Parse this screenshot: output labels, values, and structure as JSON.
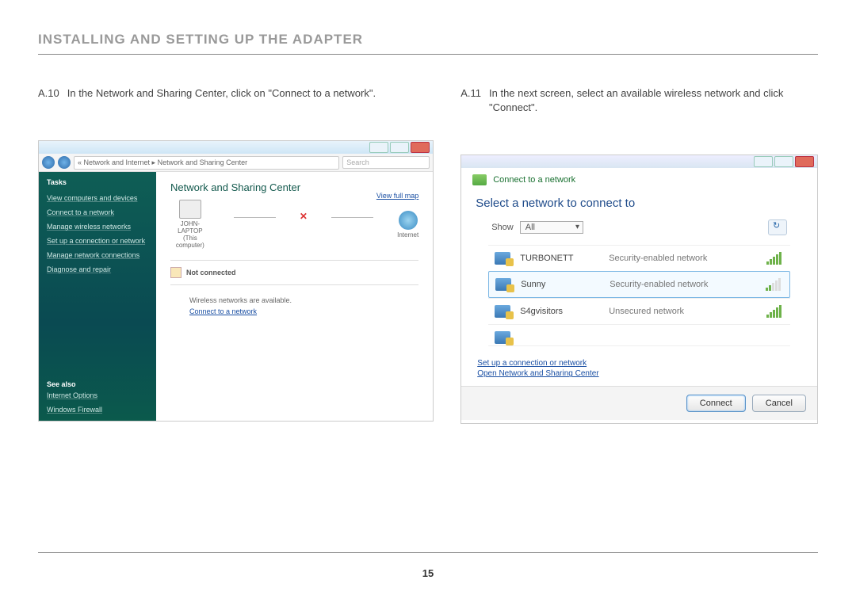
{
  "header": "INSTALLING AND SETTING UP THE ADAPTER",
  "pageNumber": "15",
  "left": {
    "stepNum": "A.10",
    "stepText": "In the Network and Sharing Center, click on \"Connect to a network\".",
    "breadcrumb": "« Network and Internet  ▸  Network and Sharing Center",
    "searchPlaceholder": "Search",
    "sidebar": {
      "heading": "Tasks",
      "items": [
        "View computers and devices",
        "Connect to a network",
        "Manage wireless networks",
        "Set up a connection or network",
        "Manage network connections",
        "Diagnose and repair"
      ],
      "seeAlsoHeading": "See also",
      "seeAlso": [
        "Internet Options",
        "Windows Firewall"
      ]
    },
    "main": {
      "title": "Network and Sharing Center",
      "viewFullMap": "View full map",
      "nodePC": "JOHN-LAPTOP",
      "nodePCsub": "(This computer)",
      "nodeNet": "Internet",
      "status": "Not connected",
      "infoText": "Wireless networks are available.",
      "infoLink": "Connect to a network"
    }
  },
  "right": {
    "stepNum": "A.11",
    "stepText": "In the next screen, select an available wireless network and click \"Connect\".",
    "headerText": "Connect to a network",
    "subtitle": "Select a network to connect to",
    "showLabel": "Show",
    "showValue": "All",
    "networks": [
      {
        "name": "TURBONETT",
        "security": "Security-enabled network",
        "strong": true
      },
      {
        "name": "Sunny",
        "security": "Security-enabled network",
        "strong": false,
        "selected": true
      },
      {
        "name": "S4gvisitors",
        "security": "Unsecured network",
        "strong": true
      }
    ],
    "link1": "Set up a connection or network",
    "link2": "Open Network and Sharing Center",
    "connectBtn": "Connect",
    "cancelBtn": "Cancel"
  }
}
